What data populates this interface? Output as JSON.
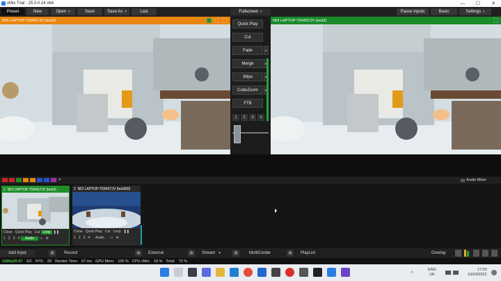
{
  "titlebar": {
    "title": "vMix Trial - 25.0.0.24 x64",
    "minimize": "—",
    "maximize": "☐",
    "close": "✕"
  },
  "toolbar": {
    "preset": "Preset",
    "new": "New",
    "open": "Open",
    "save": "Save",
    "save_as": "Save As",
    "last": "Last",
    "fullscreen": "Fullscreen",
    "pause_inputs": "Pause Inputs",
    "basic": "Basic",
    "settings": "Settings"
  },
  "preview": {
    "title": "NDI LAPTOP-T594S7JV (test3)"
  },
  "output": {
    "title": "NDI LAPTOP-T594S7JV (test3)"
  },
  "transitions": {
    "quick_play": "Quick Play",
    "cut": "Cut",
    "fade": "Fade",
    "merge": "Merge",
    "wipe": "Wipe",
    "cubezoom": "CubeZoom",
    "ftb": "FTB",
    "numbers": [
      "1",
      "2",
      "3",
      "4"
    ]
  },
  "audio_mixer": "Audio Mixer",
  "inputs": [
    {
      "number": "1",
      "title": "NDI LAPTOP-T594S7JV (test3)",
      "header_color": "#1f8f2a",
      "row1": [
        "Close",
        "Quick Play",
        "Cut",
        "Loop"
      ],
      "row2": [
        "1",
        "2",
        "3",
        "4"
      ],
      "audio": "Audio"
    },
    {
      "number": "2",
      "title": "NDI LAPTOP-T594S7JV (test360)",
      "header_color": "#2a2a2a",
      "row1": [
        "Close",
        "Quick Play",
        "Cut",
        "Loop"
      ],
      "row2": [
        "1",
        "2",
        "3",
        "4"
      ],
      "audio": "Audio"
    }
  ],
  "bottombar": {
    "add_input": "Add Input",
    "record": "Record",
    "external": "External",
    "stream": "Stream",
    "multicorder": "MultiCorder",
    "playlist": "PlayList",
    "overlay": "Overlay"
  },
  "status": {
    "format": "1080p29.97",
    "ex": "EX",
    "fps_label": "FPS:",
    "fps": "29",
    "render_label": "Render Time:",
    "render": "67 ms",
    "gpu_label": "GPU Mem:",
    "gpu": "100 %",
    "cpu_label": "CPU vMix:",
    "cpu": "18 %",
    "total_label": "Total:",
    "total": "73 %"
  },
  "taskbar": {
    "lang1": "ENG",
    "lang2": "UK",
    "time": "17:20",
    "date": "10/03/2022"
  },
  "colors": {
    "preview": "#e8850e",
    "output": "#1a8a2a",
    "swatches": [
      "#cc2222",
      "#2a8a2a",
      "#e8850e",
      "#2255cc",
      "#9933aa"
    ]
  }
}
